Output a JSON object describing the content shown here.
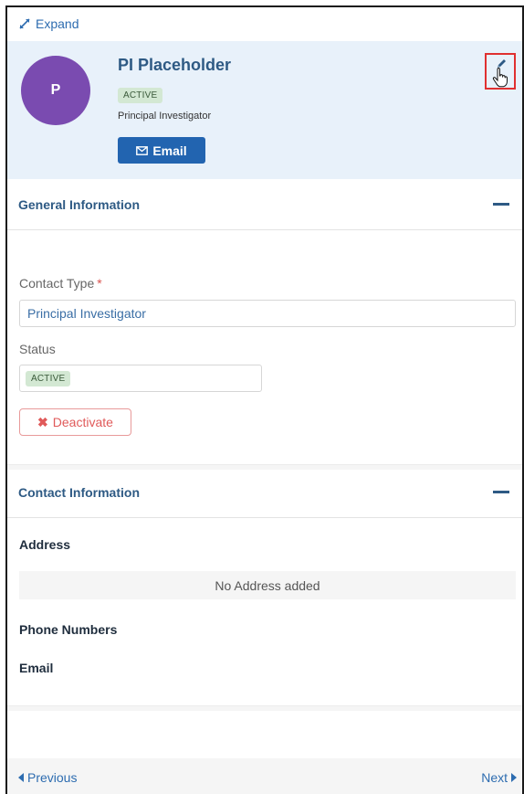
{
  "panel": {
    "expand_label": "Expand"
  },
  "header": {
    "avatar_initial": "P",
    "name": "PI Placeholder",
    "status_badge": "ACTIVE",
    "role": "Principal Investigator",
    "email_button": "Email"
  },
  "general_info": {
    "title": "General Information",
    "contact_type_label": "Contact Type",
    "required_marker": "*",
    "contact_type_value": "Principal Investigator",
    "status_label": "Status",
    "status_value": "ACTIVE",
    "deactivate_button": "Deactivate"
  },
  "contact_info": {
    "title": "Contact Information",
    "address_label": "Address",
    "no_address_text": "No Address added",
    "phone_label": "Phone Numbers",
    "email_label": "Email"
  },
  "footer": {
    "previous_label": "Previous",
    "next_label": "Next"
  },
  "colors": {
    "accent": "#2264b0",
    "header_bg": "#e8f1fa",
    "avatar": "#7a4bb0",
    "danger": "#e05a5a",
    "highlight": "#e03030"
  },
  "icons": {
    "expand": "expand-arrows-icon",
    "email": "envelope-icon",
    "edit": "pencil-icon",
    "cursor": "hand-pointer-icon",
    "collapse": "minus-icon",
    "deactivate": "x-icon",
    "previous": "caret-left-icon",
    "next": "caret-right-icon"
  }
}
